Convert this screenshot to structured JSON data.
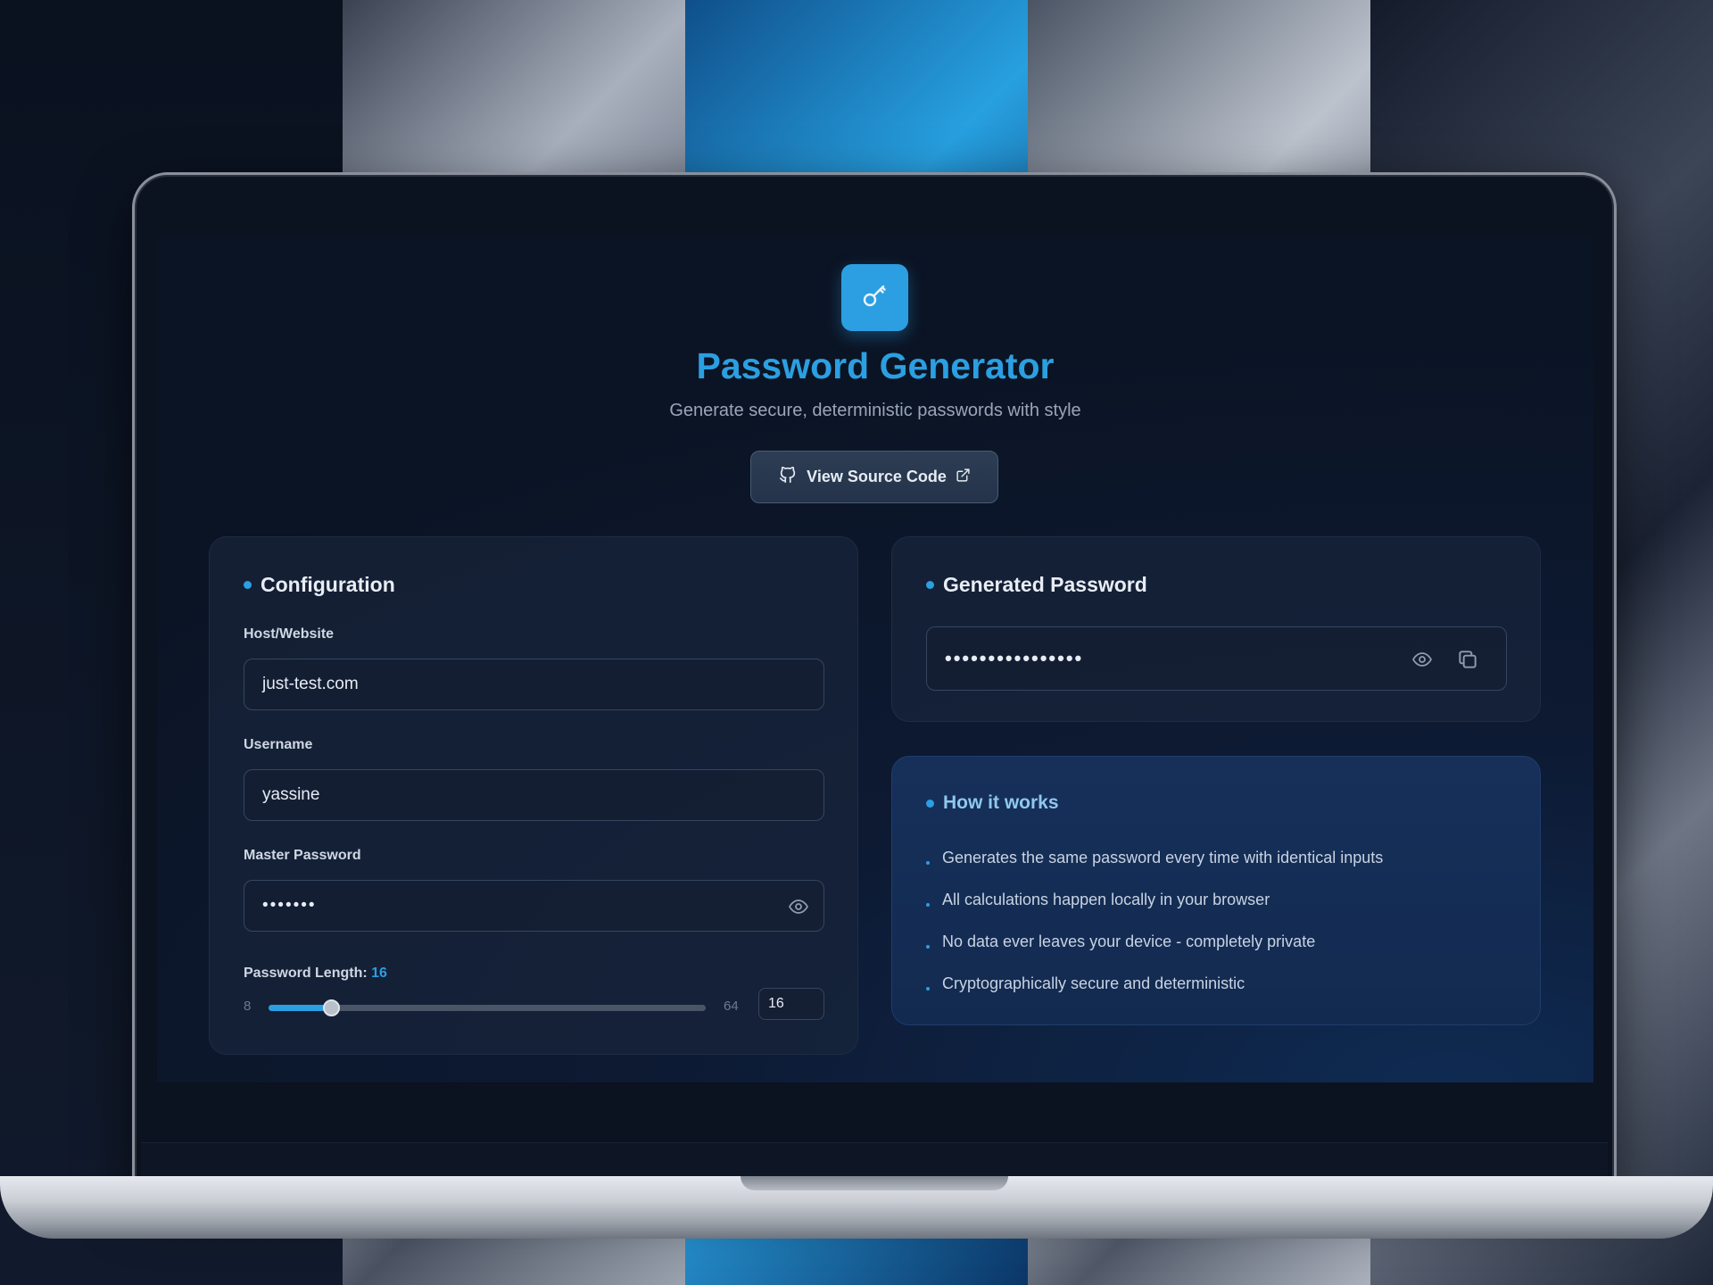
{
  "header": {
    "title": "Password Generator",
    "subtitle": "Generate secure, deterministic passwords with style",
    "source_button_label": "View Source Code"
  },
  "config": {
    "heading": "Configuration",
    "host_label": "Host/Website",
    "host_value": "just-test.com",
    "username_label": "Username",
    "username_value": "yassine",
    "master_label": "Master Password",
    "master_value": "•••••••",
    "length_label": "Password Length:",
    "length_value": "16",
    "length_fraction": 0.143,
    "range_min": "8",
    "range_max": "64",
    "length_input": "16"
  },
  "generated": {
    "heading": "Generated Password",
    "masked_value": "••••••••••••••••"
  },
  "how": {
    "heading": "How it works",
    "items": [
      "Generates the same password every time with identical inputs",
      "All calculations happen locally in your browser",
      "No data ever leaves your device - completely private",
      "Cryptographically secure and deterministic"
    ]
  },
  "colors": {
    "accent": "#2b9fe1",
    "background": "#0b1424",
    "card": "#18243a"
  }
}
